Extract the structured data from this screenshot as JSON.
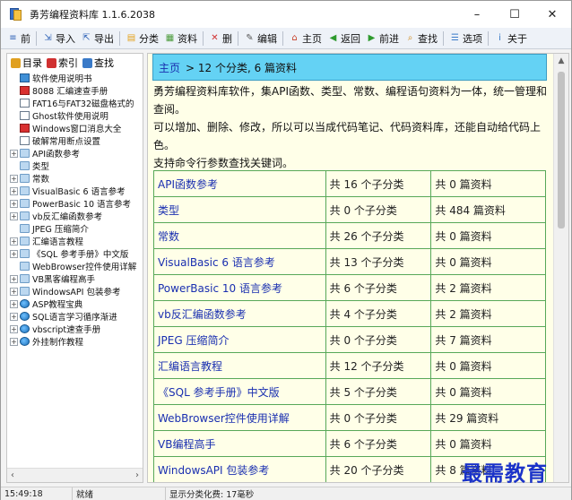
{
  "window": {
    "title": "勇芳编程资料库 1.1.6.2038"
  },
  "window_controls": {
    "minimize": "–",
    "maximize": "☐",
    "close": "✕"
  },
  "toolbar": [
    {
      "label": "前",
      "icon": "menu-icon",
      "color": "#2a5fb5"
    },
    {
      "label": "导入",
      "icon": "import-icon",
      "color": "#2a5fb5"
    },
    {
      "label": "导出",
      "icon": "export-icon",
      "color": "#2a5fb5"
    },
    {
      "label": "分类",
      "icon": "category-icon",
      "color": "#e5a21b"
    },
    {
      "label": "资料",
      "icon": "data-icon",
      "color": "#4a9a3a"
    },
    {
      "label": "删",
      "icon": "delete-icon",
      "color": "#d03030"
    },
    {
      "label": "编辑",
      "icon": "edit-icon",
      "color": "#555555"
    },
    {
      "label": "主页",
      "icon": "home-icon",
      "color": "#c8402a"
    },
    {
      "label": "返回",
      "icon": "back-icon",
      "color": "#2e9a2e"
    },
    {
      "label": "前进",
      "icon": "forward-icon",
      "color": "#2e9a2e"
    },
    {
      "label": "查找",
      "icon": "search-icon",
      "color": "#d08a1a"
    },
    {
      "label": "选项",
      "icon": "options-icon",
      "color": "#3a7ac8"
    },
    {
      "label": "关于",
      "icon": "about-icon",
      "color": "#3a7ac8"
    }
  ],
  "tree_tabs": [
    {
      "label": "目录",
      "color": "#e0a020"
    },
    {
      "label": "索引",
      "color": "#d03030"
    },
    {
      "label": "查找",
      "color": "#3a7ac8"
    }
  ],
  "tree_items": [
    {
      "label": "软件使用说明书",
      "icon": "book",
      "expand": ""
    },
    {
      "label": "8088 汇编速查手册",
      "icon": "red",
      "expand": ""
    },
    {
      "label": "FAT16与FAT32磁盘格式的",
      "icon": "doc",
      "expand": ""
    },
    {
      "label": "Ghost软件使用说明",
      "icon": "doc",
      "expand": ""
    },
    {
      "label": "Windows窗口消息大全",
      "icon": "red",
      "expand": ""
    },
    {
      "label": "破解常用断点设置",
      "icon": "doc",
      "expand": ""
    },
    {
      "label": "API函数参考",
      "icon": "folder",
      "expand": "+"
    },
    {
      "label": "类型",
      "icon": "folder",
      "expand": ""
    },
    {
      "label": "常数",
      "icon": "folder",
      "expand": "+"
    },
    {
      "label": "VisualBasic 6 语言参考",
      "icon": "folder",
      "expand": "+"
    },
    {
      "label": "PowerBasic 10 语言参考",
      "icon": "folder",
      "expand": "+"
    },
    {
      "label": "vb反汇编函数参考",
      "icon": "folder",
      "expand": "+"
    },
    {
      "label": "JPEG 压缩简介",
      "icon": "folder",
      "expand": ""
    },
    {
      "label": "汇编语言教程",
      "icon": "folder",
      "expand": "+"
    },
    {
      "label": "《SQL 参考手册》中文版",
      "icon": "folder",
      "expand": "+"
    },
    {
      "label": "WebBrowser控件使用详解",
      "icon": "folder",
      "expand": ""
    },
    {
      "label": "VB黑客编程高手",
      "icon": "folder",
      "expand": "+"
    },
    {
      "label": "WindowsAPI 包装参考",
      "icon": "folder",
      "expand": "+"
    },
    {
      "label": "ASP教程宝典",
      "icon": "globe",
      "expand": "+"
    },
    {
      "label": "SQL语言学习循序渐进",
      "icon": "globe",
      "expand": "+"
    },
    {
      "label": "vbscript速查手册",
      "icon": "globe",
      "expand": "+"
    },
    {
      "label": "外挂制作教程",
      "icon": "globe",
      "expand": "+"
    }
  ],
  "content": {
    "breadcrumb": {
      "home": "主页",
      "summary": "> 12 个分类,   6 篇资料"
    },
    "description": [
      "勇芳编程资料库软件，集API函数、类型、常数、编程语句资料为一体，统一管理和查阅。",
      "可以增加、删除、修改，所以可以当成代码笔记、代码资料库，还能自动给代码上色。",
      "支持命令行参数查找关键词。"
    ],
    "rows": [
      {
        "name": "API函数参考",
        "sub": "共 16 个子分类",
        "count": "共 0 篇资料"
      },
      {
        "name": "类型",
        "sub": "共 0 个子分类",
        "count": "共 484 篇资料"
      },
      {
        "name": "常数",
        "sub": "共 26 个子分类",
        "count": "共 0 篇资料"
      },
      {
        "name": "VisualBasic 6 语言参考",
        "sub": "共 13 个子分类",
        "count": "共 0 篇资料"
      },
      {
        "name": "PowerBasic 10 语言参考",
        "sub": "共 6 个子分类",
        "count": "共 2 篇资料"
      },
      {
        "name": "vb反汇编函数参考",
        "sub": "共 4 个子分类",
        "count": "共 2 篇资料"
      },
      {
        "name": "JPEG 压缩简介",
        "sub": "共 0 个子分类",
        "count": "共 7 篇资料"
      },
      {
        "name": "汇编语言教程",
        "sub": "共 12 个子分类",
        "count": "共 0 篇资料"
      },
      {
        "name": "《SQL 参考手册》中文版",
        "sub": "共 5 个子分类",
        "count": "共 0 篇资料"
      },
      {
        "name": "WebBrowser控件使用详解",
        "sub": "共 0 个子分类",
        "count": "共 29 篇资料"
      },
      {
        "name": "VB编程高手",
        "sub": "共 6 个子分类",
        "count": "共 0 篇资料"
      },
      {
        "name": "WindowsAPI 包装参考",
        "sub": "共 20 个子分类",
        "count": "共 8 篇资料"
      }
    ]
  },
  "statusbar": {
    "time": "15:49:18",
    "mode": "就绪",
    "message": "显示分类化费: 17毫秒"
  },
  "watermark": "最需教育"
}
